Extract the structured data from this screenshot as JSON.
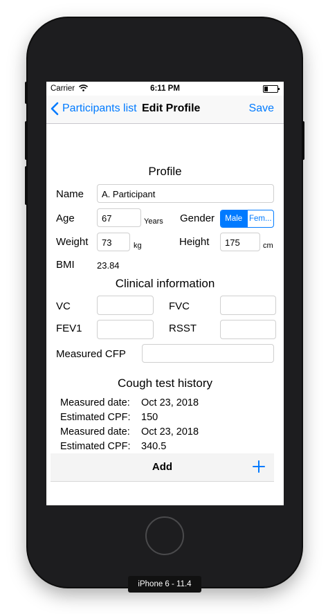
{
  "status_bar": {
    "carrier": "Carrier",
    "time": "6:11 PM"
  },
  "nav": {
    "back_label": "Participants list",
    "title": "Edit Profile",
    "save_label": "Save"
  },
  "profile": {
    "section_title": "Profile",
    "name_label": "Name",
    "name_value": "A. Participant",
    "age_label": "Age",
    "age_value": "67",
    "age_unit": "Years",
    "gender_label": "Gender",
    "gender_options": [
      "Male",
      "Fem..."
    ],
    "gender_selected": "Male",
    "weight_label": "Weight",
    "weight_value": "73",
    "weight_unit": "kg",
    "height_label": "Height",
    "height_value": "175",
    "height_unit": "cm",
    "bmi_label": "BMI",
    "bmi_value": "23.84"
  },
  "clinical": {
    "section_title": "Clinical information",
    "vc_label": "VC",
    "vc_value": "",
    "fvc_label": "FVC",
    "fvc_value": "",
    "fev1_label": "FEV1",
    "fev1_value": "",
    "rsst_label": "RSST",
    "rsst_value": "",
    "cfp_label": "Measured CFP",
    "cfp_value": ""
  },
  "history": {
    "section_title": "Cough test history",
    "entries": [
      {
        "date_label": "Measured date:",
        "date_value": "Oct 23, 2018",
        "cpf_label": "Estimated CPF:",
        "cpf_value": "150"
      },
      {
        "date_label": "Measured date:",
        "date_value": "Oct 23, 2018",
        "cpf_label": "Estimated CPF:",
        "cpf_value": "340.5"
      }
    ],
    "add_label": "Add"
  },
  "device_label": "iPhone 6 - 11.4",
  "colors": {
    "accent": "#007aff",
    "bezel": "#1d1d1f",
    "separator": "#c8c7cc"
  },
  "icons": {
    "back": "chevron-left-icon",
    "add": "plus-icon",
    "wifi": "wifi-icon",
    "battery": "battery-icon"
  }
}
